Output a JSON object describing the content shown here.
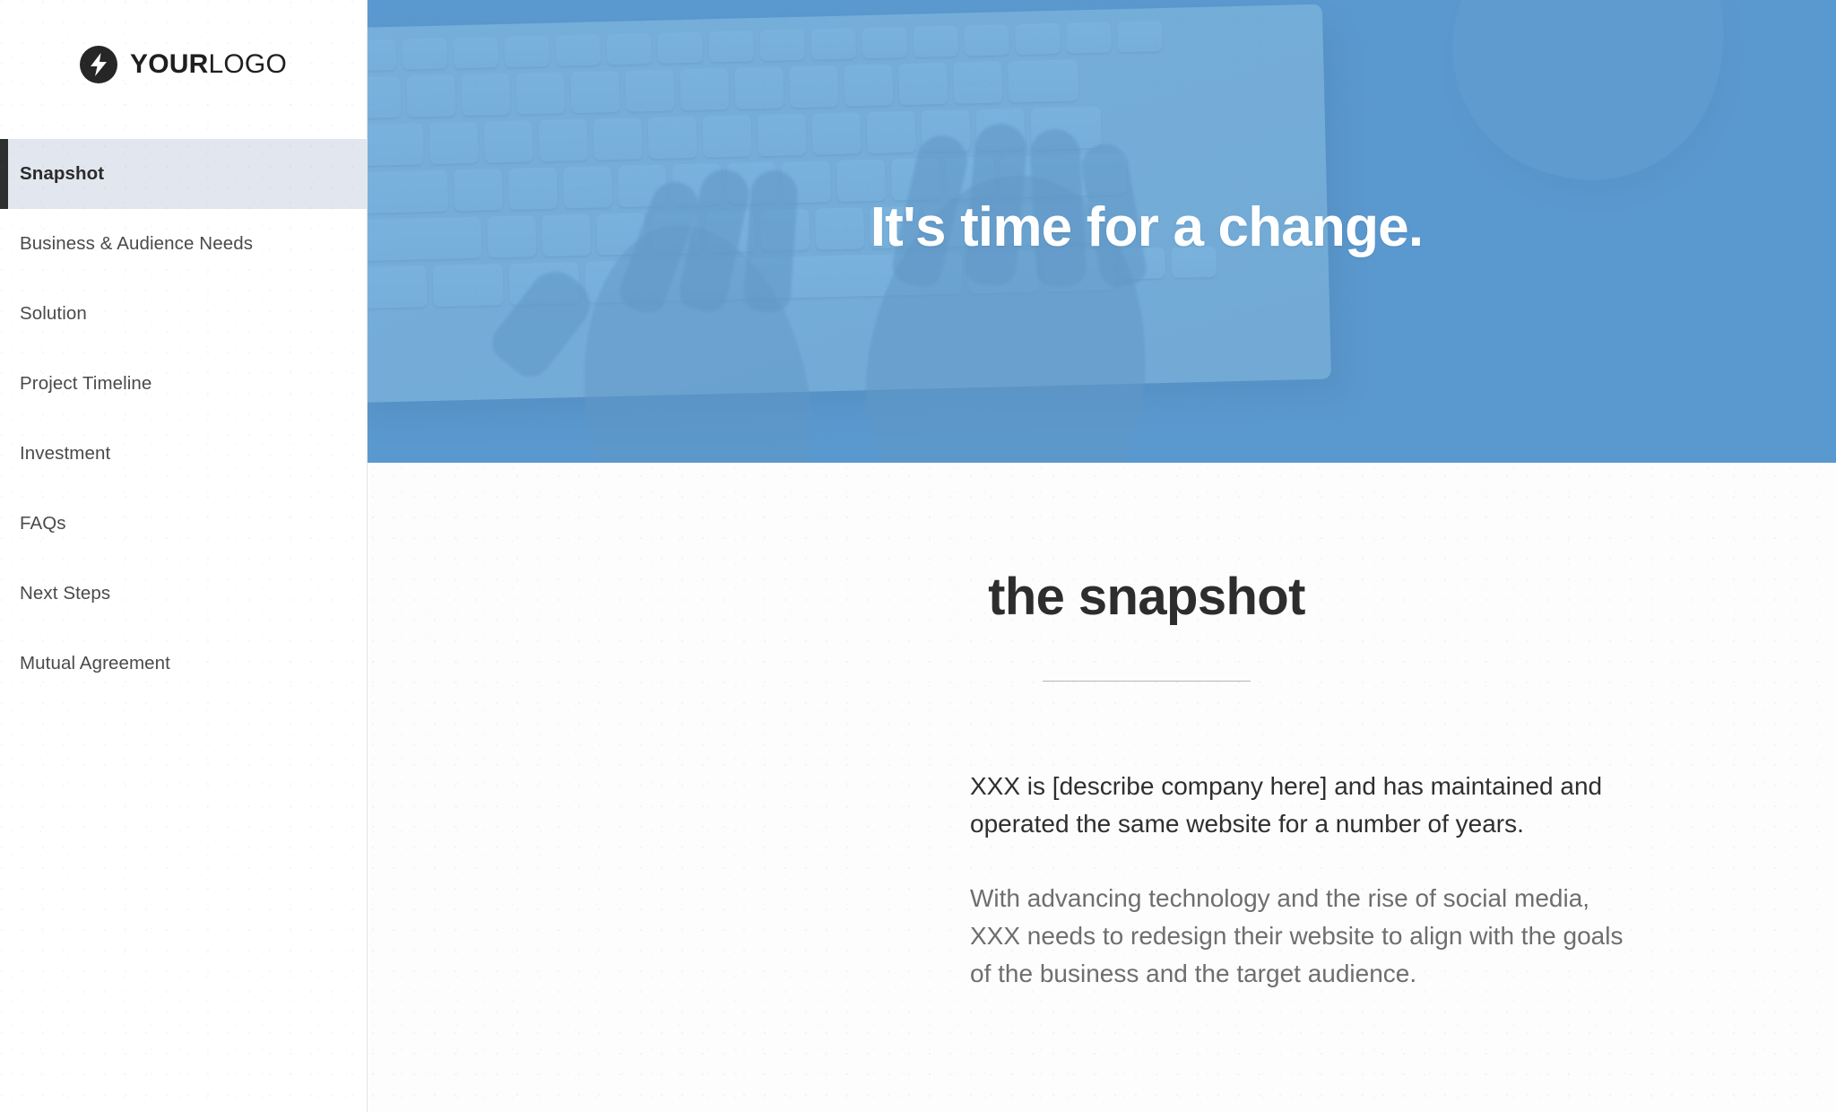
{
  "sidebar": {
    "logo": {
      "icon": "lightning-bolt-icon",
      "text_bold": "YOUR",
      "text_light": "LOGO"
    },
    "items": [
      {
        "label": "Snapshot",
        "active": true
      },
      {
        "label": "Business & Audience Needs",
        "active": false
      },
      {
        "label": "Solution",
        "active": false
      },
      {
        "label": "Project Timeline",
        "active": false
      },
      {
        "label": "Investment",
        "active": false
      },
      {
        "label": "FAQs",
        "active": false
      },
      {
        "label": "Next Steps",
        "active": false
      },
      {
        "label": "Mutual Agreement",
        "active": false
      }
    ]
  },
  "hero": {
    "title": "It's time for a change.",
    "overlay_color": "#74b0dd",
    "image_subject": "hands typing on a white keyboard with a mouse and a wristwatch on a desk"
  },
  "content": {
    "section_title": "the snapshot",
    "paragraphs": [
      "XXX is [describe company here] and has maintained and operated the same website for a number of years.",
      "With advancing technology and the rise of social media, XXX needs to redesign their website to align with the goals of the business and the target audience."
    ]
  },
  "colors": {
    "accent_blue": "#74b0dd",
    "active_nav_bg": "#e2e6ee",
    "active_nav_bar": "#2f2f2f",
    "heading": "#2d2d2d",
    "body_text": "#2f2f2f",
    "muted_text": "#6e6e6e"
  }
}
